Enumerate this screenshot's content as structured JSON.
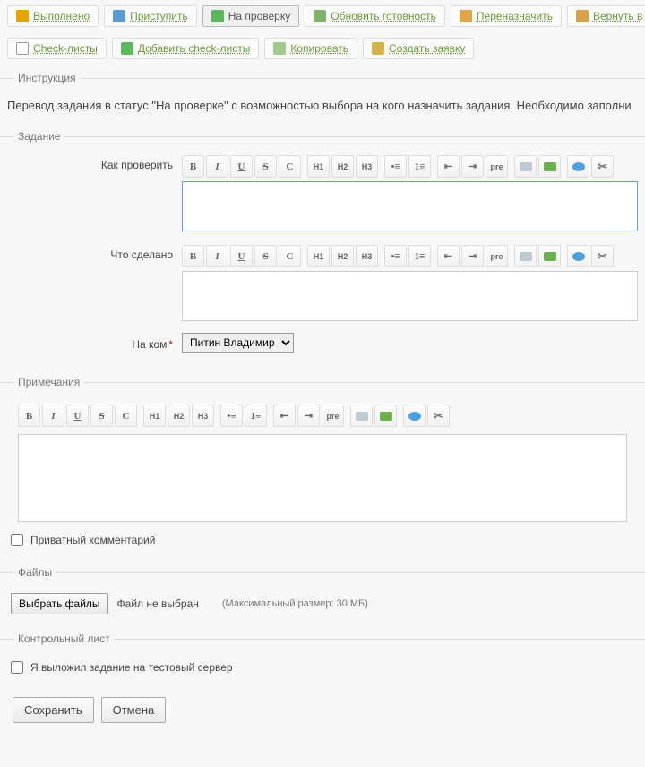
{
  "toolbar1": [
    {
      "name": "done",
      "icon": "lock",
      "label": "Выполнено"
    },
    {
      "name": "start",
      "icon": "play",
      "label": "Приступить"
    },
    {
      "name": "review",
      "icon": "shield",
      "label": "На проверку",
      "active": true
    },
    {
      "name": "refresh",
      "icon": "chart",
      "label": "Обновить готовность"
    },
    {
      "name": "reassign",
      "icon": "hand",
      "label": "Переназначить"
    },
    {
      "name": "return",
      "icon": "ret",
      "label": "Вернуть в"
    }
  ],
  "toolbar2": [
    {
      "name": "checklists",
      "icon": "check",
      "label": "Check-листы"
    },
    {
      "name": "add-checklists",
      "icon": "plus",
      "label": "Добавить check-листы"
    },
    {
      "name": "copy",
      "icon": "copy",
      "label": "Копировать"
    },
    {
      "name": "create",
      "icon": "edit",
      "label": "Создать заявку"
    }
  ],
  "sections": {
    "instruction_legend": "Инструкция",
    "instruction_text": "Перевод задания в статус \"На проверке\" с возможностью выбора на кого назначить задания. Необходимо заполни",
    "task_legend": "Задание",
    "how_label": "Как проверить",
    "done_label": "Что сделано",
    "who_label": "На ком",
    "who_value": "Питин Владимир",
    "notes_legend": "Примечания",
    "private_label": "Приватный комментарий",
    "files_legend": "Файлы",
    "choose_btn": "Выбрать файлы",
    "no_file": "Файл не выбран",
    "max_size": "(Максимальный размер: 30 МБ)",
    "checklist_legend": "Контрольный лист",
    "checklist_item": "Я выложил задание на тестовый сервер"
  },
  "footer": {
    "save": "Сохранить",
    "cancel": "Отмена"
  },
  "editor_buttons": [
    {
      "n": "bold",
      "t": "B",
      "c": ""
    },
    {
      "n": "italic",
      "t": "I",
      "c": "i"
    },
    {
      "n": "underline",
      "t": "U",
      "c": "u"
    },
    {
      "n": "strike",
      "t": "S",
      "c": "s"
    },
    {
      "n": "code",
      "t": "C",
      "c": ""
    }
  ],
  "editor_hbtns": [
    "H1",
    "H2",
    "H3"
  ]
}
